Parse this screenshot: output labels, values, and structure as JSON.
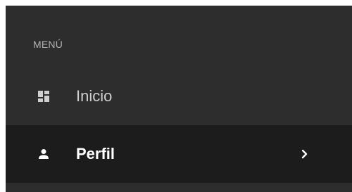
{
  "menu": {
    "section_label": "MENÚ",
    "items": [
      {
        "label": "Inicio",
        "icon": "dashboard-icon",
        "active": false
      },
      {
        "label": "Perfil",
        "icon": "user-icon",
        "active": true,
        "submenu_icon": "chevron-right-icon"
      }
    ]
  },
  "colors": {
    "panel_bg": "#2d2d2d",
    "active_item_bg": "#1c1c1c",
    "label_muted": "#b0b0b0",
    "item_text": "#cfcfcf",
    "active_text": "#ffffff"
  }
}
